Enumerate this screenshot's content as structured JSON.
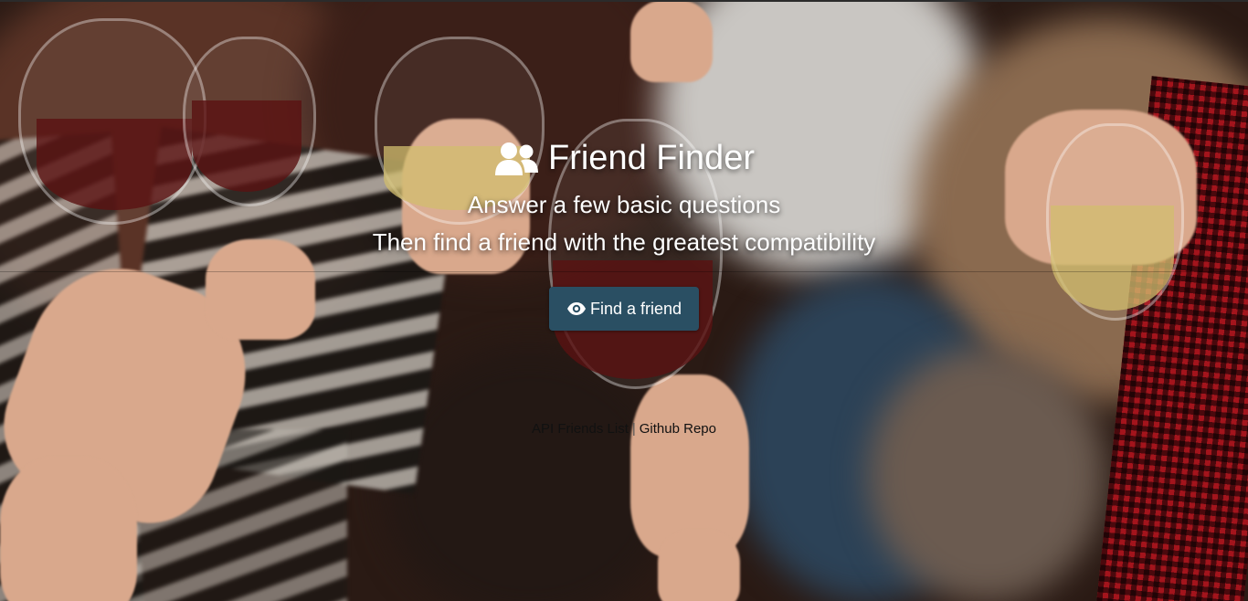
{
  "header": {
    "icon": "users-icon",
    "title": "Friend Finder",
    "subtitle_1": "Answer a few basic questions",
    "subtitle_2": "Then find a friend with the greatest compatibility"
  },
  "cta": {
    "icon": "eye-icon",
    "label": "Find a friend",
    "color": "#2a4f63"
  },
  "footer": {
    "link_api": "API Friends List",
    "separator": "|",
    "link_repo": "Github Repo"
  }
}
